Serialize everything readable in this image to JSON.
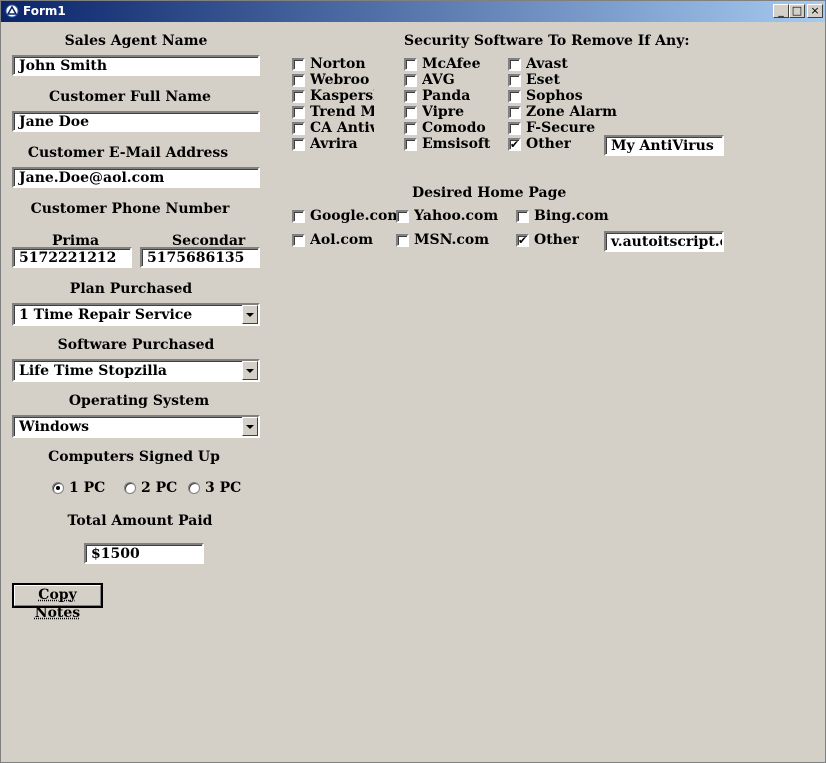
{
  "window": {
    "title": "Form1",
    "minimize": "_",
    "maximize": "□",
    "close": "×"
  },
  "agent": {
    "label": "Sales Agent Name",
    "value": "John Smith"
  },
  "customer_name": {
    "label": "Customer Full Name",
    "value": "Jane Doe"
  },
  "customer_email": {
    "label": "Customer E-Mail Address",
    "value": "Jane.Doe@aol.com"
  },
  "phone": {
    "label": "Customer Phone Number",
    "primary_label": "Prima",
    "primary_value": "5172221212",
    "secondary_label": "Secondar",
    "secondary_value": "5175686135"
  },
  "plan": {
    "label": "Plan Purchased",
    "value": "1 Time Repair Service"
  },
  "software": {
    "label": "Software Purchased",
    "value": "Life Time Stopzilla"
  },
  "os": {
    "label": "Operating System",
    "value": "Windows"
  },
  "computers": {
    "label": "Computers Signed Up",
    "options": [
      "1 PC",
      "2 PC",
      "3 PC"
    ],
    "selected": "1 PC"
  },
  "total": {
    "label": "Total Amount Paid",
    "value": "$1500"
  },
  "copy_button": {
    "label": "Copy Notes"
  },
  "security": {
    "label": "Security Software To Remove If Any:",
    "items": [
      {
        "label": "Norton",
        "checked": false
      },
      {
        "label": "Webroo",
        "checked": false
      },
      {
        "label": "Kaspersky",
        "checked": false
      },
      {
        "label": "Trend Mic",
        "checked": false
      },
      {
        "label": "CA Antivi",
        "checked": false
      },
      {
        "label": "Avrira",
        "checked": false
      },
      {
        "label": "McAfee",
        "checked": false
      },
      {
        "label": "AVG",
        "checked": false
      },
      {
        "label": "Panda",
        "checked": false
      },
      {
        "label": "Vipre",
        "checked": false
      },
      {
        "label": "Comodo",
        "checked": false
      },
      {
        "label": "Emsisoft",
        "checked": false
      },
      {
        "label": "Avast",
        "checked": false
      },
      {
        "label": "Eset",
        "checked": false
      },
      {
        "label": "Sophos",
        "checked": false
      },
      {
        "label": "Zone Alarm",
        "checked": false
      },
      {
        "label": "F-Secure",
        "checked": false
      },
      {
        "label": "Other",
        "checked": true
      }
    ],
    "other_value": "My AntiVirus"
  },
  "homepage": {
    "label": "Desired Home Page",
    "items": [
      {
        "label": "Google.com",
        "checked": false
      },
      {
        "label": "Yahoo.com",
        "checked": false
      },
      {
        "label": "Bing.com",
        "checked": false
      },
      {
        "label": "Aol.com",
        "checked": false
      },
      {
        "label": "MSN.com",
        "checked": false
      },
      {
        "label": "Other",
        "checked": true
      }
    ],
    "other_value": "v.autoitscript.com"
  }
}
